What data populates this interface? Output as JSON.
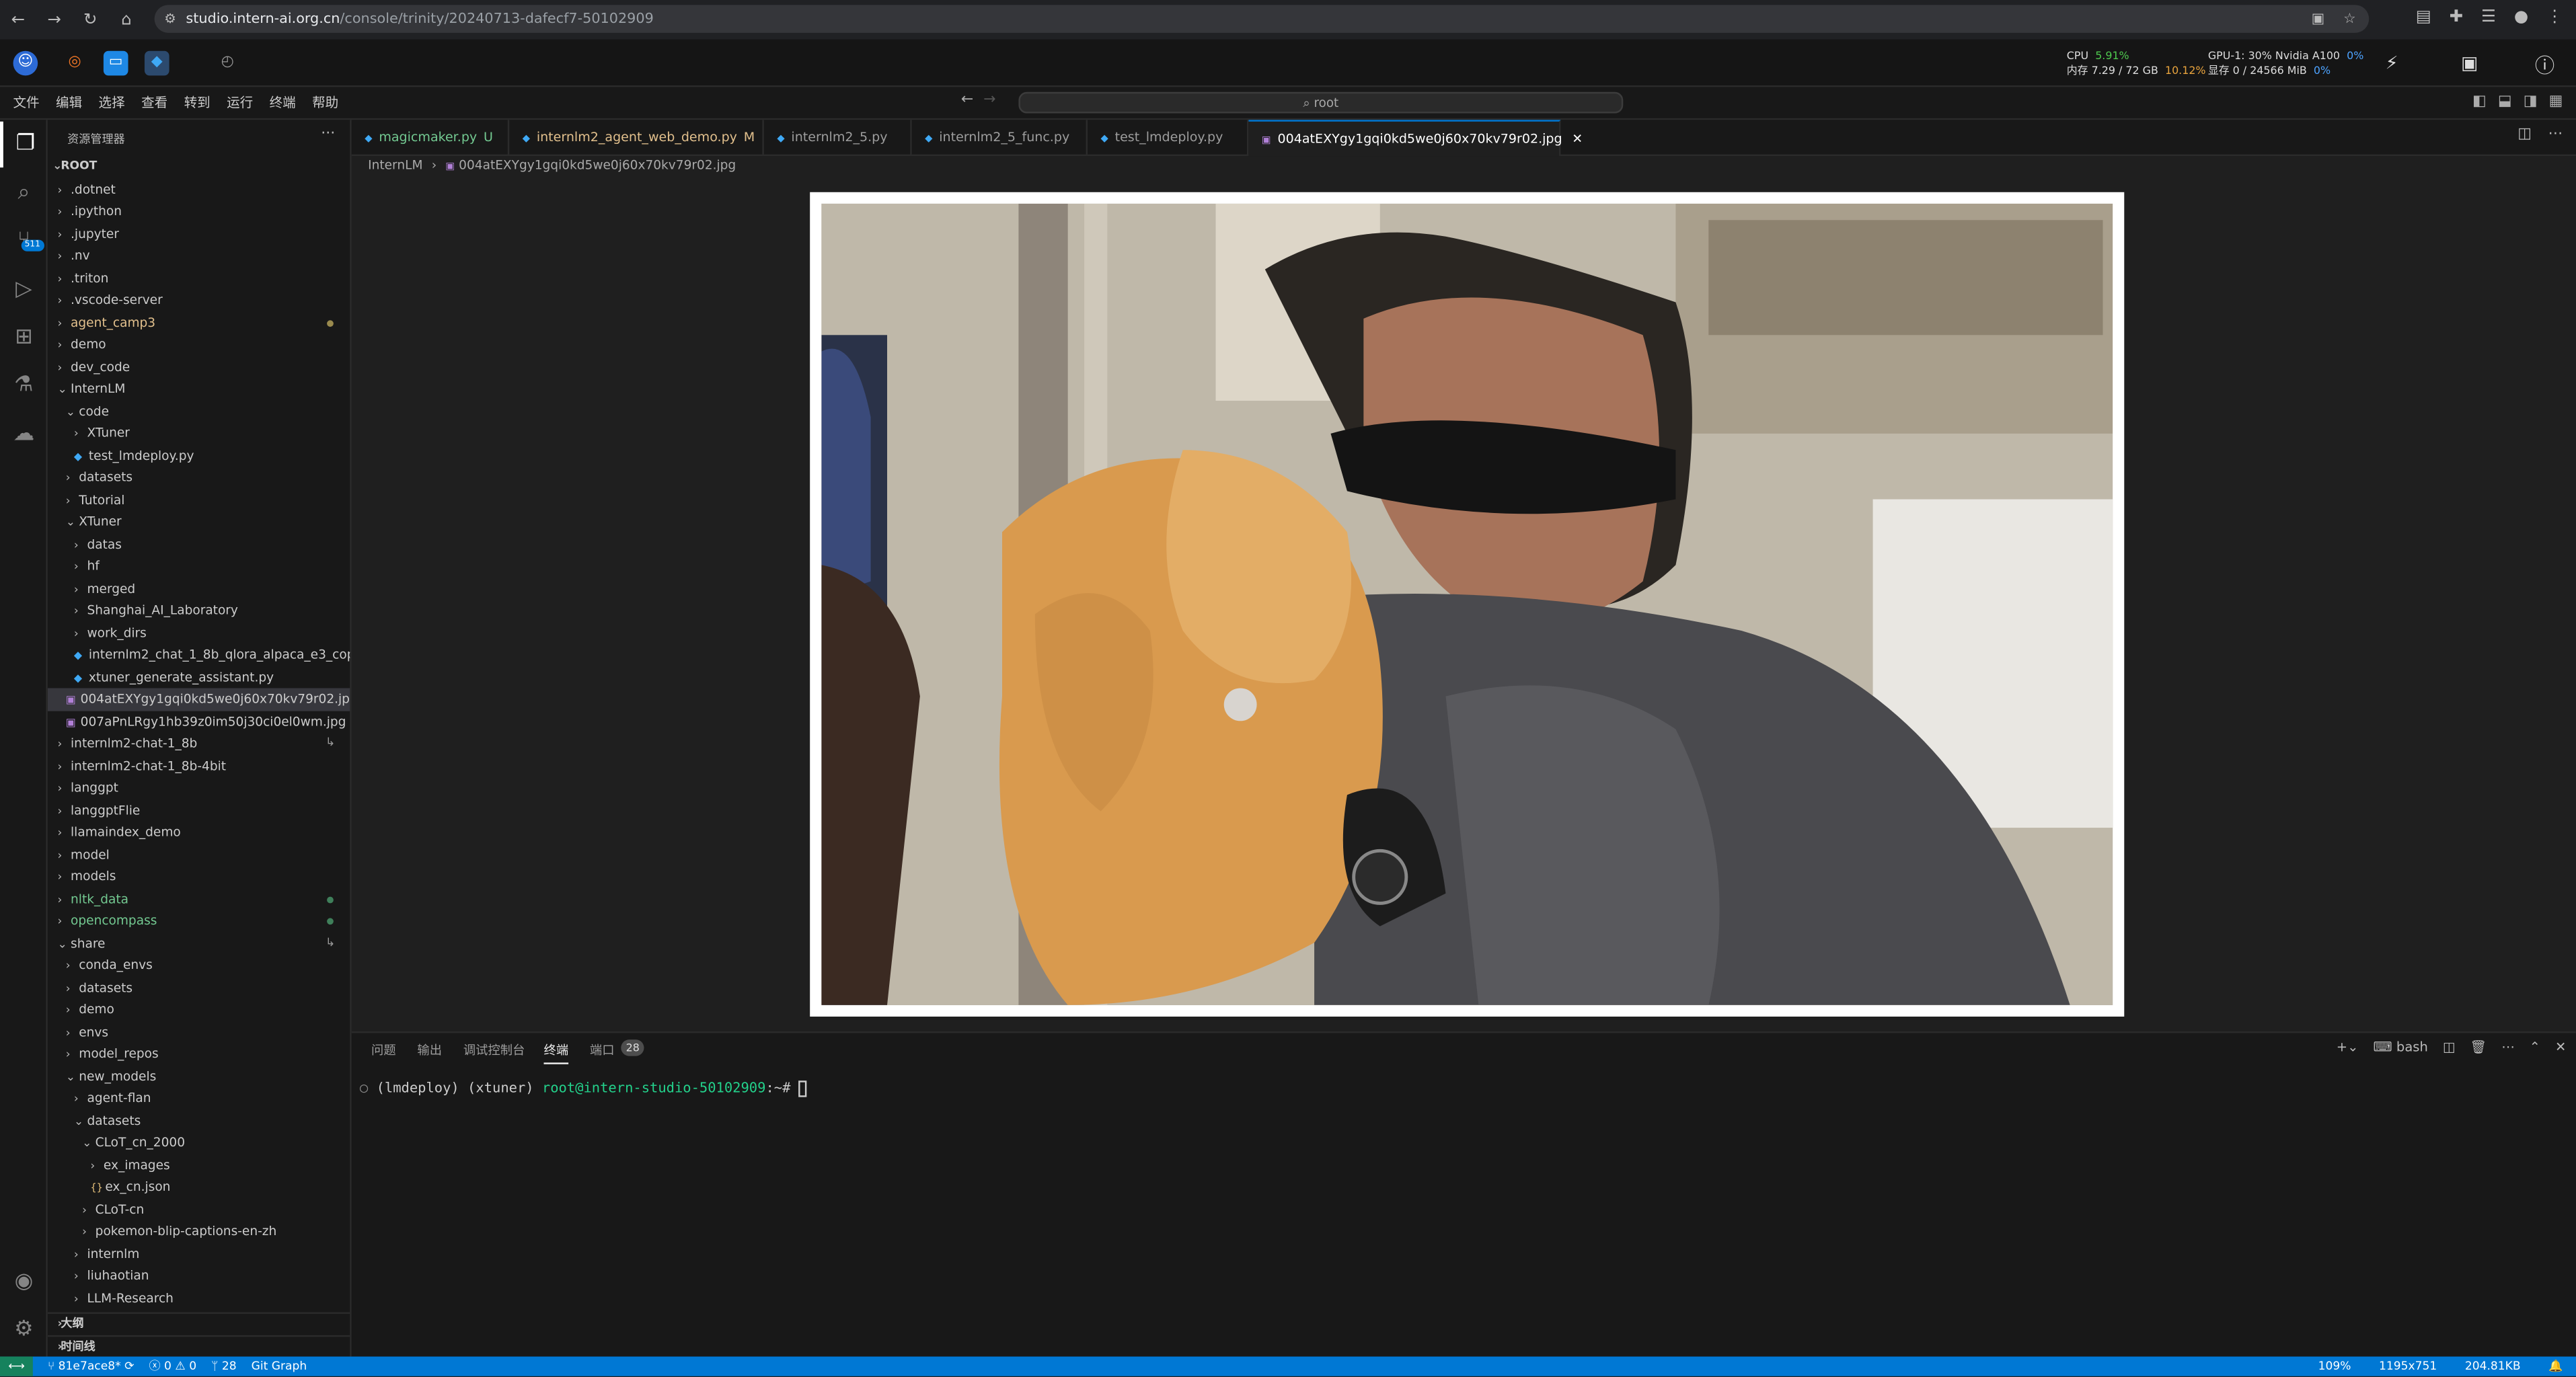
{
  "browser": {
    "url_host": "studio.intern-ai.org.cn",
    "url_path": "/console/trinity/20240713-dafecf7-50102909"
  },
  "resources": {
    "cpu_label": "CPU",
    "cpu_value": "5.91%",
    "mem_label": "内存 7.29 / 72 GB",
    "mem_value": "10.12%",
    "gpu_label": "GPU-1: 30% Nvidia A100",
    "gpu_value": "0%",
    "vram_label": "显存 0 / 24566 MiB",
    "vram_value": "0%"
  },
  "menu": [
    "文件",
    "编辑",
    "选择",
    "查看",
    "转到",
    "运行",
    "终端",
    "帮助"
  ],
  "command_center": "root",
  "activity_badge": "511",
  "sidebar": {
    "title": "资源管理器",
    "root_label": "ROOT",
    "tree": [
      {
        "label": ".dotnet",
        "type": "dir",
        "open": false,
        "depth": 1
      },
      {
        "label": ".ipython",
        "type": "dir",
        "open": false,
        "depth": 1
      },
      {
        "label": ".jupyter",
        "type": "dir",
        "open": false,
        "depth": 1
      },
      {
        "label": ".nv",
        "type": "dir",
        "open": false,
        "depth": 1
      },
      {
        "label": ".triton",
        "type": "dir",
        "open": false,
        "depth": 1
      },
      {
        "label": ".vscode-server",
        "type": "dir",
        "open": false,
        "depth": 1
      },
      {
        "label": "agent_camp3",
        "type": "dir",
        "open": false,
        "depth": 1,
        "color": "#e2c08d",
        "dot": "#9a8a4e"
      },
      {
        "label": "demo",
        "type": "dir",
        "open": false,
        "depth": 1
      },
      {
        "label": "dev_code",
        "type": "dir",
        "open": false,
        "depth": 1
      },
      {
        "label": "InternLM",
        "type": "dir",
        "open": true,
        "depth": 1
      },
      {
        "label": "code",
        "type": "dir",
        "open": true,
        "depth": 2
      },
      {
        "label": "XTuner",
        "type": "dir",
        "open": false,
        "depth": 3
      },
      {
        "label": "test_lmdeploy.py",
        "type": "py",
        "depth": 3
      },
      {
        "label": "datasets",
        "type": "dir",
        "open": false,
        "depth": 2
      },
      {
        "label": "Tutorial",
        "type": "dir",
        "open": false,
        "depth": 2
      },
      {
        "label": "XTuner",
        "type": "dir",
        "open": true,
        "depth": 2
      },
      {
        "label": "datas",
        "type": "dir",
        "open": false,
        "depth": 3
      },
      {
        "label": "hf",
        "type": "dir",
        "open": false,
        "depth": 3
      },
      {
        "label": "merged",
        "type": "dir",
        "open": false,
        "depth": 3
      },
      {
        "label": "Shanghai_AI_Laboratory",
        "type": "dir",
        "open": false,
        "depth": 3
      },
      {
        "label": "work_dirs",
        "type": "dir",
        "open": false,
        "depth": 3
      },
      {
        "label": "internlm2_chat_1_8b_qlora_alpaca_e3_cop...",
        "type": "py",
        "depth": 3
      },
      {
        "label": "xtuner_generate_assistant.py",
        "type": "py",
        "depth": 3
      },
      {
        "label": "004atEXYgy1gqi0kd5we0j60x70kv79r02.jpg",
        "type": "img",
        "depth": 2,
        "selected": true
      },
      {
        "label": "007aPnLRgy1hb39z0im50j30ci0el0wm.jpg",
        "type": "img",
        "depth": 2
      },
      {
        "label": "internlm2-chat-1_8b",
        "type": "dir",
        "open": false,
        "depth": 1,
        "sym": "↳"
      },
      {
        "label": "internlm2-chat-1_8b-4bit",
        "type": "dir",
        "open": false,
        "depth": 1
      },
      {
        "label": "langgpt",
        "type": "dir",
        "open": false,
        "depth": 1
      },
      {
        "label": "langgptFlie",
        "type": "dir",
        "open": false,
        "depth": 1
      },
      {
        "label": "llamaindex_demo",
        "type": "dir",
        "open": false,
        "depth": 1
      },
      {
        "label": "model",
        "type": "dir",
        "open": false,
        "depth": 1
      },
      {
        "label": "models",
        "type": "dir",
        "open": false,
        "depth": 1
      },
      {
        "label": "nltk_data",
        "type": "dir",
        "open": false,
        "depth": 1,
        "color": "#73c991",
        "dot": "#3f7f5a"
      },
      {
        "label": "opencompass",
        "type": "dir",
        "open": false,
        "depth": 1,
        "color": "#73c991",
        "dot": "#3f7f5a"
      },
      {
        "label": "share",
        "type": "dir",
        "open": true,
        "depth": 1,
        "sym": "↳"
      },
      {
        "label": "conda_envs",
        "type": "dir",
        "open": false,
        "depth": 2
      },
      {
        "label": "datasets",
        "type": "dir",
        "open": false,
        "depth": 2
      },
      {
        "label": "demo",
        "type": "dir",
        "open": false,
        "depth": 2
      },
      {
        "label": "envs",
        "type": "dir",
        "open": false,
        "depth": 2
      },
      {
        "label": "model_repos",
        "type": "dir",
        "open": false,
        "depth": 2
      },
      {
        "label": "new_models",
        "type": "dir",
        "open": true,
        "depth": 2
      },
      {
        "label": "agent-flan",
        "type": "dir",
        "open": false,
        "depth": 3
      },
      {
        "label": "datasets",
        "type": "dir",
        "open": true,
        "depth": 3
      },
      {
        "label": "CLoT_cn_2000",
        "type": "dir",
        "open": true,
        "depth": 4
      },
      {
        "label": "ex_images",
        "type": "dir",
        "open": false,
        "depth": 5
      },
      {
        "label": "ex_cn.json",
        "type": "json",
        "depth": 5
      },
      {
        "label": "CLoT-cn",
        "type": "dir",
        "open": false,
        "depth": 4
      },
      {
        "label": "pokemon-blip-captions-en-zh",
        "type": "dir",
        "open": false,
        "depth": 4
      },
      {
        "label": "internlm",
        "type": "dir",
        "open": false,
        "depth": 3
      },
      {
        "label": "liuhaotian",
        "type": "dir",
        "open": false,
        "depth": 3
      },
      {
        "label": "LLM-Research",
        "type": "dir",
        "open": false,
        "depth": 3
      }
    ],
    "outline_label": "大纲",
    "timeline_label": "时间线"
  },
  "tabs": [
    {
      "label": "magicmaker.py",
      "suffix": "U",
      "color": "#73c991"
    },
    {
      "label": "internlm2_agent_web_demo.py",
      "suffix": "M",
      "color": "#e2c08d"
    },
    {
      "label": "internlm2_5.py",
      "suffix": "",
      "color": "#9d9d9d"
    },
    {
      "label": "internlm2_5_func.py",
      "suffix": "",
      "color": "#9d9d9d"
    },
    {
      "label": "test_lmdeploy.py",
      "suffix": "",
      "color": "#9d9d9d"
    },
    {
      "label": "004atEXYgy1gqi0kd5we0j60x70kv79r02.jpg",
      "suffix": "",
      "color": "#ffffff",
      "active": true
    }
  ],
  "breadcrumb": {
    "folder": "InternLM",
    "file": "004atEXYgy1gqi0kd5we0j60x70kv79r02.jpg"
  },
  "panel": {
    "tabs": [
      "问题",
      "输出",
      "调试控制台",
      "终端",
      "端口"
    ],
    "active_tab": "终端",
    "ports_count": "28",
    "terminal_kind": "bash",
    "prompt_envs": "(lmdeploy) (xtuner) ",
    "prompt_user": "root@intern-studio-50102909",
    "prompt_tail": ":~# "
  },
  "status": {
    "branch": "81e7ace8*",
    "errors": "0",
    "warnings": "0",
    "ports": "28",
    "git_graph": "Git Graph",
    "zoom": "109%",
    "dimensions": "1195x751",
    "size": "204.81KB"
  }
}
